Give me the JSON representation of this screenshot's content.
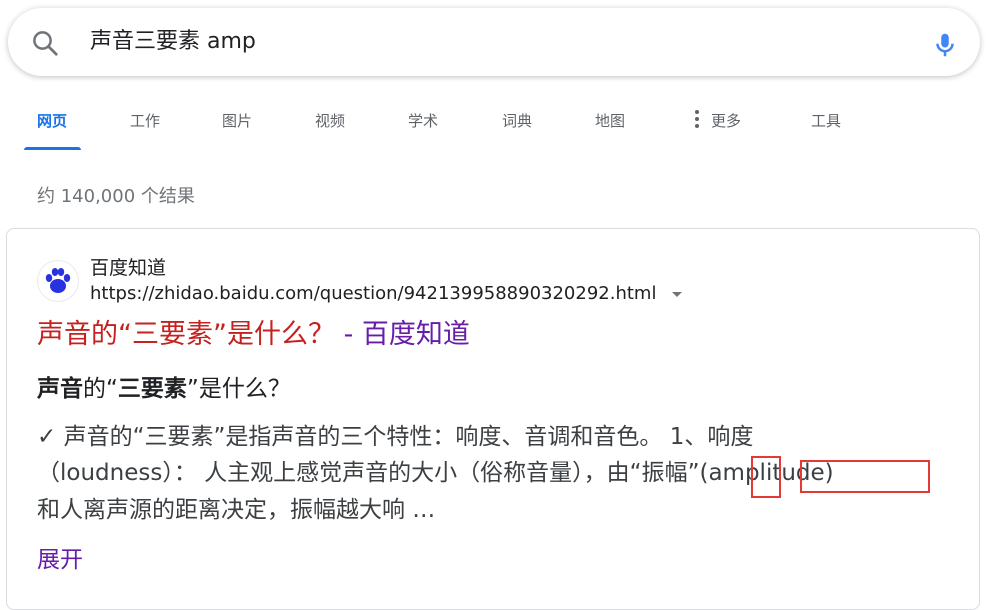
{
  "search": {
    "query": "声音三要素 amp",
    "search_icon": "search-icon",
    "mic_icon": "microphone-icon"
  },
  "tabs": [
    {
      "label": "网页",
      "active": true
    },
    {
      "label": "工作"
    },
    {
      "label": "图片"
    },
    {
      "label": "视频"
    },
    {
      "label": "学术"
    },
    {
      "label": "词典"
    },
    {
      "label": "地图"
    },
    {
      "label": "更多"
    },
    {
      "label": "工具"
    }
  ],
  "result_stats": "约 140,000 个结果",
  "result": {
    "site_name": "百度知道",
    "site_icon": "baidu-paw-icon",
    "url": "https://zhidao.baidu.com/question/942139958890320292.html",
    "title_part1": "声音的“三要素”是什么？",
    "title_part2": " - 百度知道",
    "heading_bold1": "声音",
    "heading_mid": "的“",
    "heading_bold2": "三要素",
    "heading_end": "”是什么？",
    "snippet_line1": "✓ 声音的“三要素”是指声音的三个特性：响度、音调和音色。 1、响度",
    "snippet_line2_a": "（loudness）： 人主观上感觉声音的大小（俗称音量），由“振",
    "snippet_line2_hl1": "幅",
    "snippet_line2_b": "”",
    "snippet_line2_hl2": "(amplitude)",
    "snippet_line3": "和人离声源的距离决定，振幅越大响 …",
    "expand_label": "展开"
  },
  "colors": {
    "accent": "#1a73e8",
    "title_red": "#c5221f",
    "title_purple": "#681da8",
    "highlight_box": "#e53935"
  }
}
